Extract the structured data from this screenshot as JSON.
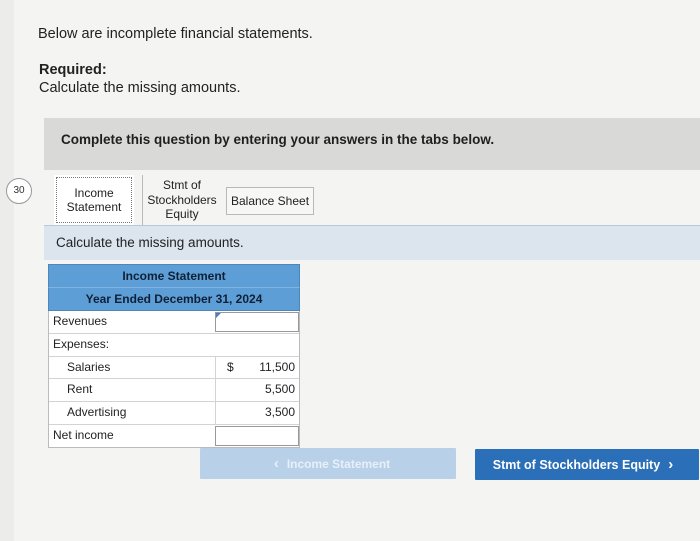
{
  "side_marker": "30",
  "intro": "Below are incomplete financial statements.",
  "required_label": "Required:",
  "required_text": "Calculate the missing amounts.",
  "card": {
    "heading": "Complete this question by entering your answers in the tabs below.",
    "tabs": [
      {
        "label": "Income Statement",
        "active": true
      },
      {
        "label": "Stmt of Stockholders Equity",
        "active": false
      },
      {
        "label": "Balance Sheet",
        "active": false
      }
    ],
    "instruction": "Calculate the missing amounts."
  },
  "statement": {
    "title": "Income Statement",
    "period": "Year Ended December 31, 2024",
    "rows": [
      {
        "label": "Revenues",
        "value": "",
        "input": true
      },
      {
        "label": "Expenses:",
        "value": ""
      },
      {
        "label": "Salaries",
        "value": "11,500",
        "currency": "$"
      },
      {
        "label": "Rent",
        "value": "5,500"
      },
      {
        "label": "Advertising",
        "value": "3,500"
      },
      {
        "label": "Net income",
        "value": "",
        "input": true
      }
    ]
  },
  "nav": {
    "prev_label": "Income Statement",
    "next_label": "Stmt of Stockholders Equity",
    "prev_icon": "chevron-left-icon",
    "next_icon": "chevron-right-icon"
  },
  "colors": {
    "header_blue": "#5e9ed6",
    "next_button": "#2b6fb8",
    "prev_button_disabled": "#b9d1e8",
    "instruction_band": "#dce4ee"
  }
}
